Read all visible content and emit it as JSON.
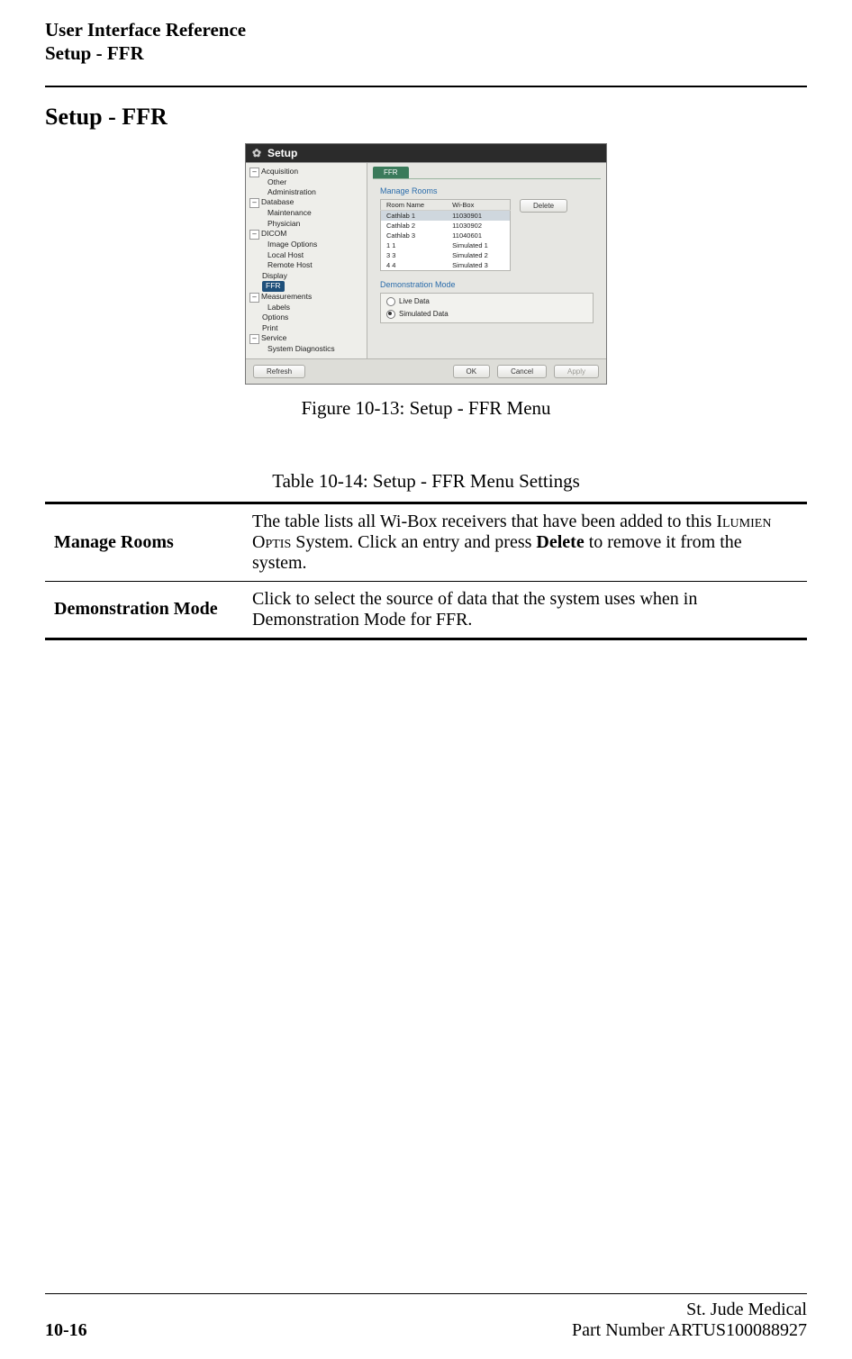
{
  "header": {
    "line1": "User Interface Reference",
    "line2": "Setup - FFR"
  },
  "section_title": "Setup - FFR",
  "figure": {
    "caption": "Figure 10-13:  Setup - FFR Menu",
    "window": {
      "title": "Setup",
      "gear_icon": "✿",
      "tree": {
        "items": [
          {
            "label": "Acquisition",
            "expandable": true,
            "children": [
              {
                "label": "Other"
              },
              {
                "label": "Administration"
              }
            ]
          },
          {
            "label": "Database",
            "expandable": true,
            "children": [
              {
                "label": "Maintenance"
              },
              {
                "label": "Physician"
              }
            ]
          },
          {
            "label": "DICOM",
            "expandable": true,
            "children": [
              {
                "label": "Image Options"
              },
              {
                "label": "Local Host"
              },
              {
                "label": "Remote Host"
              }
            ]
          },
          {
            "label": "Display"
          },
          {
            "label": "FFR",
            "selected": true
          },
          {
            "label": "Measurements",
            "expandable": true,
            "children": [
              {
                "label": "Labels"
              }
            ]
          },
          {
            "label": "Options"
          },
          {
            "label": "Print"
          },
          {
            "label": "Service",
            "expandable": true,
            "children": [
              {
                "label": "System Diagnostics"
              }
            ]
          }
        ]
      },
      "pane": {
        "tab_label": "FFR",
        "manage_rooms": {
          "title": "Manage Rooms",
          "columns": [
            "Room Name",
            "Wi-Box"
          ],
          "rows": [
            {
              "room": "Cathlab 1",
              "wibox": "11030901",
              "selected": true
            },
            {
              "room": "Cathlab 2",
              "wibox": "11030902"
            },
            {
              "room": "Cathlab 3",
              "wibox": "11040601"
            },
            {
              "room": "1 1",
              "wibox": "Simulated 1"
            },
            {
              "room": "3 3",
              "wibox": "Simulated 2"
            },
            {
              "room": "4 4",
              "wibox": "Simulated 3"
            }
          ],
          "delete_label": "Delete"
        },
        "demo_mode": {
          "title": "Demonstration Mode",
          "live_label": "Live Data",
          "simulated_label": "Simulated Data",
          "selected": "simulated"
        }
      },
      "footer": {
        "refresh": "Refresh",
        "ok": "OK",
        "cancel": "Cancel",
        "apply": "Apply"
      }
    }
  },
  "table": {
    "caption": "Table 10-14:  Setup - FFR Menu Settings",
    "rows": [
      {
        "name": "Manage Rooms",
        "desc_pre": "The table lists all Wi-Box receivers that have been added to this ",
        "desc_sc": "Ilumien Optis",
        "desc_mid": " System.  Click an entry and press ",
        "desc_bold": "Delete",
        "desc_post": " to remove it from the system."
      },
      {
        "name": "Demonstration Mode",
        "desc": "Click to select the source of data that the system uses when in Demonstration Mode for FFR."
      }
    ]
  },
  "footer": {
    "page": "10-16",
    "company": "St. Jude Medical",
    "part": "Part Number ARTUS100088927"
  }
}
